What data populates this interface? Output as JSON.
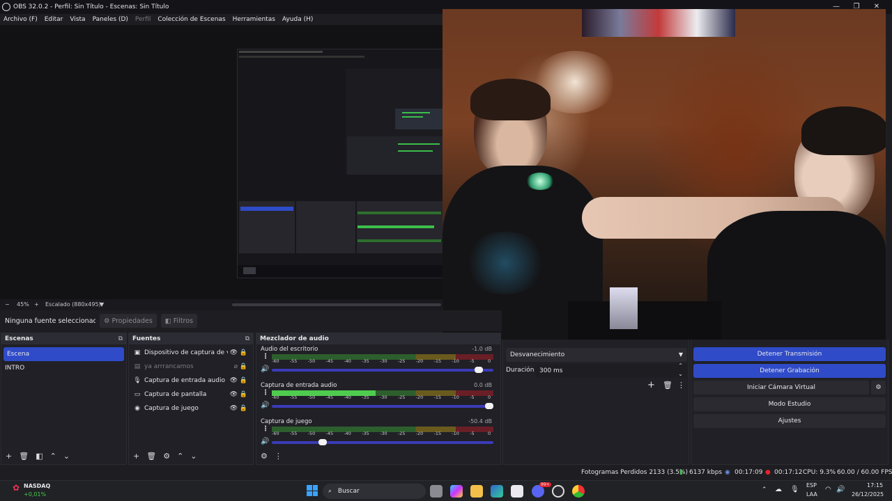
{
  "window": {
    "title": "OBS 32.0.2 - Perfil: Sin Título - Escenas: Sin Título"
  },
  "menu": {
    "items": [
      "Archivo (F)",
      "Editar",
      "Vista",
      "Paneles (D)",
      "Perfil",
      "Colección de Escenas",
      "Herramientas",
      "Ayuda (H)"
    ]
  },
  "zoom": {
    "minus": "−",
    "level": "45%",
    "plus": "+",
    "scale": "Escalado (880x495)"
  },
  "props": {
    "no_source": "Ninguna fuente seleccionac",
    "properties": "Propiedades",
    "filters": "Filtros"
  },
  "scenes": {
    "title": "Escenas",
    "items": [
      "Escena",
      "INTRO"
    ],
    "selected": 0
  },
  "sources": {
    "title": "Fuentes",
    "items": [
      {
        "label": "Dispositivo de captura de vide",
        "icon": "camera-icon",
        "visible": true
      },
      {
        "label": "ya arrrancamos",
        "icon": "text-icon",
        "visible": false
      },
      {
        "label": "Captura de entrada audio",
        "icon": "microphone-icon",
        "visible": true
      },
      {
        "label": "Captura de pantalla",
        "icon": "monitor-icon",
        "visible": true
      },
      {
        "label": "Captura de juego",
        "icon": "gamepad-icon",
        "visible": true
      }
    ]
  },
  "mixer": {
    "title": "Mezclador de audio",
    "ticks": [
      "-60",
      "-55",
      "-50",
      "-45",
      "-40",
      "-35",
      "-30",
      "-25",
      "-20",
      "-15",
      "-10",
      "-5",
      "0"
    ],
    "channels": [
      {
        "name": "Audio del escritorio",
        "db": "-1.0 dB",
        "volume": 0.95,
        "level": 0.0
      },
      {
        "name": "Captura de entrada audio",
        "db": "0.0 dB",
        "volume": 1.0,
        "level": 0.47
      },
      {
        "name": "Captura de juego",
        "db": "-50.4 dB",
        "volume": 0.22,
        "level": 0.0
      }
    ]
  },
  "transitions": {
    "type": "Desvanecimiento",
    "duration_label": "Duración",
    "duration": "300 ms"
  },
  "controls": {
    "stop_stream": "Detener Transmisión",
    "stop_record": "Detener Grabación",
    "virtual_cam": "Iniciar Cámara Virtual",
    "studio_mode": "Modo Estudio",
    "settings": "Ajustes"
  },
  "status": {
    "dropped": "Fotogramas Perdidos 2133 (3.5%)",
    "bitrate": "6137 kbps",
    "stream_time": "00:17:09",
    "rec_time": "00:17:12",
    "cpu": "CPU: 9.3%",
    "fps": "60.00 / 60.00 FPS"
  },
  "taskbar": {
    "ticker_name": "NASDAQ",
    "ticker_change": "+0,01%",
    "search": "Buscar",
    "lang": "ESP",
    "lang2": "LAA",
    "time": "17:15",
    "date": "26/12/2025",
    "notif": "99+"
  },
  "colors": {
    "accent": "#2f4bc8",
    "meter_green": "#4ecc4e",
    "record_red": "#e0242e"
  }
}
